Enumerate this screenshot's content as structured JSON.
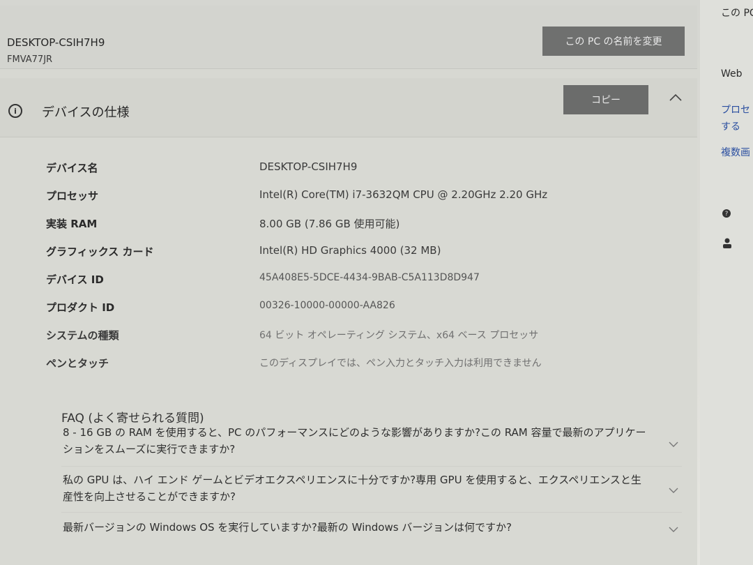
{
  "pc": {
    "name": "DESKTOP-CSIH7H9",
    "model": "FMVA77JR",
    "rename_label": "この PC の名前を変更"
  },
  "spec": {
    "title": "デバイスの仕様",
    "copy_label": "コピー",
    "rows": [
      {
        "label": "デバイス名",
        "value": "DESKTOP-CSIH7H9"
      },
      {
        "label": "プロセッサ",
        "value": "Intel(R) Core(TM) i7-3632QM CPU @ 2.20GHz   2.20 GHz"
      },
      {
        "label": "実装 RAM",
        "value": "8.00 GB (7.86 GB 使用可能)"
      },
      {
        "label": "グラフィックス カード",
        "value": "Intel(R) HD Graphics 4000 (32 MB)"
      },
      {
        "label": "デバイス ID",
        "value": "45A408E5-5DCE-4434-9BAB-C5A113D8D947"
      },
      {
        "label": "プロダクト ID",
        "value": "00326-10000-00000-AA826"
      },
      {
        "label": "システムの種類",
        "value": "64 ビット オペレーティング システム、x64 ベース プロセッサ"
      },
      {
        "label": "ペンとタッチ",
        "value": "このディスプレイでは、ペン入力とタッチ入力は利用できません"
      }
    ]
  },
  "faq": {
    "title": "FAQ (よく寄せられる質問)",
    "items": [
      "8 - 16 GB の RAM を使用すると、PC のパフォーマンスにどのような影響がありますか?この RAM 容量で最新のアプリケーションをスムーズに実行できますか?",
      "私の GPU は、ハイ エンド ゲームとビデオエクスペリエンスに十分ですか?専用 GPU を使用すると、エクスペリエンスと生産性を向上させることができますか?",
      "最新バージョンの Windows OS を実行していますか?最新の Windows バージョンは何ですか?"
    ]
  },
  "right_panel": {
    "top": "この PC",
    "web": "Web",
    "proc1": "プロセ",
    "proc2": "する",
    "multi": "複数画",
    "icons": [
      "help-icon",
      "feedback-icon"
    ]
  }
}
